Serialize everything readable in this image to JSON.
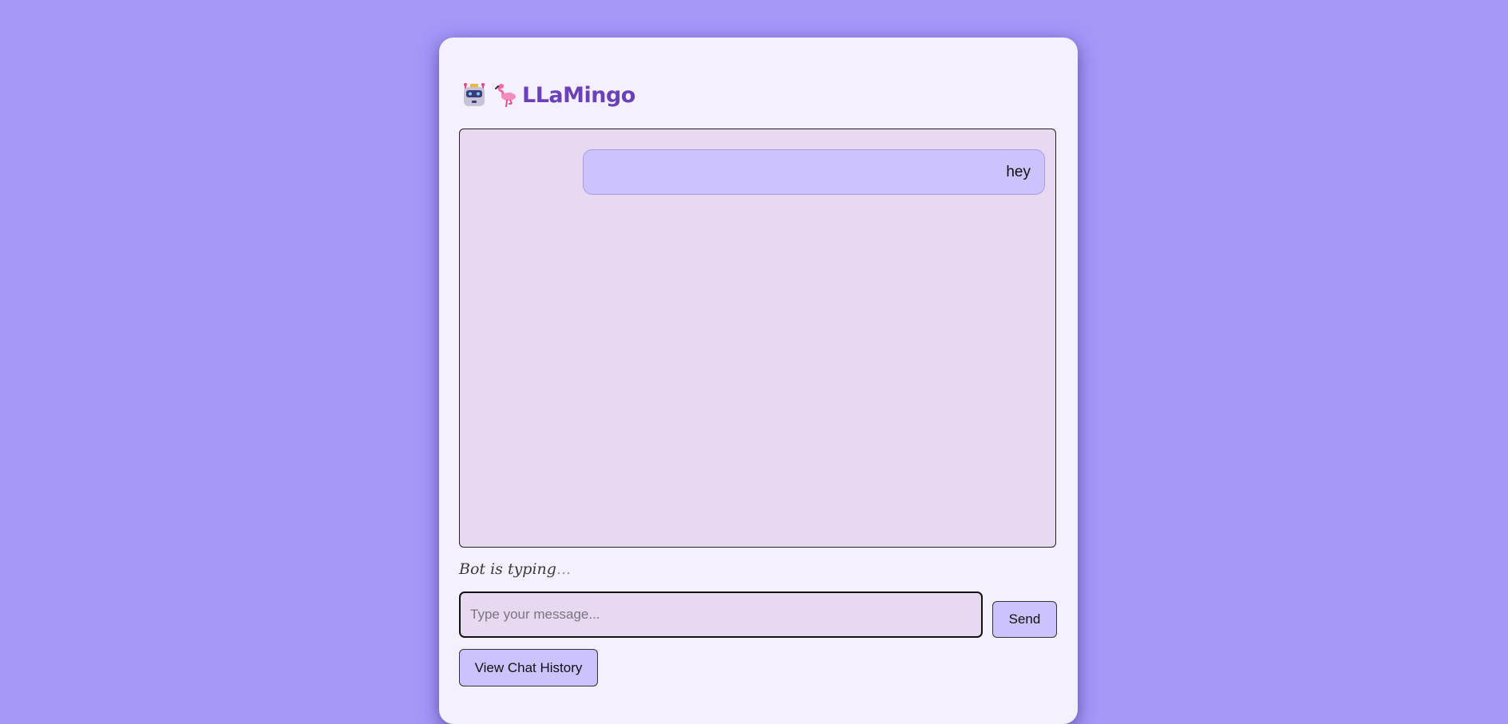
{
  "app": {
    "title": "LLaMingo"
  },
  "icons": {
    "robot": "robot-icon",
    "flamingo": "flamingo-icon"
  },
  "chat": {
    "messages": [
      {
        "sender": "user",
        "text": "hey"
      }
    ],
    "status_text": "Bot is typing",
    "status_dots": "..."
  },
  "input": {
    "value": "",
    "placeholder": "Type your message..."
  },
  "buttons": {
    "send_label": "Send",
    "history_label": "View Chat History"
  },
  "colors": {
    "background": "#a397f8",
    "card": "#f5f0fd",
    "chat_area": "#e6d9f0",
    "user_bubble": "#ccc3fd",
    "title": "#6a41b8"
  }
}
